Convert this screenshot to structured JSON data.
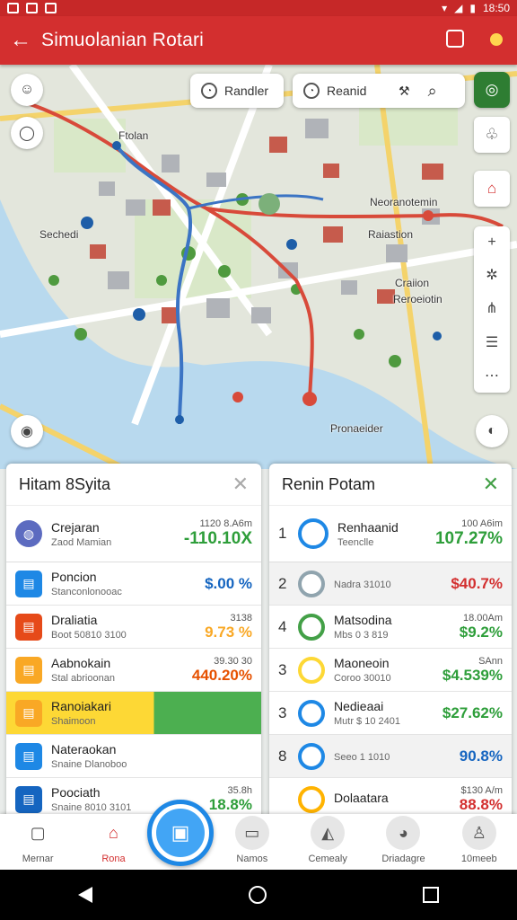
{
  "status_bar": {
    "time": "18:50"
  },
  "app_bar": {
    "title": "Simuolanian Rotari"
  },
  "map": {
    "chip_left": "Randler",
    "chip_right": "Reanid",
    "labels": [
      "Ftolan",
      "Sechedi",
      "Neoranotemin",
      "Raiastion",
      "Craiion",
      "Reroeiotin",
      "Pronaeider"
    ]
  },
  "left_panel": {
    "title": "Hitam 8Syita",
    "summary": {
      "name": "Crejaran",
      "sub": "Zaod Mamian",
      "top": "1120 8.A6m",
      "value": "-110.10X"
    },
    "rows": [
      {
        "name": "Poncion",
        "sub": "Stanconlonooac",
        "top": "",
        "value": "$.00 %",
        "color": "blue",
        "icon_color": "#1e88e5",
        "bg": ""
      },
      {
        "name": "Draliatia",
        "sub": "Boot 50810 3100",
        "top": "3138",
        "value": "9.73 %",
        "color": "yel",
        "icon_color": "#e64a19",
        "bg": ""
      },
      {
        "name": "Aabnokain",
        "sub": "Stal abrioonan",
        "top": "39.30 30",
        "value": "440.20%",
        "color": "orange",
        "icon_color": "#f9a825",
        "bg": ""
      },
      {
        "name": "Ranoiakari",
        "sub": "Shaimoon",
        "top": "",
        "value": "",
        "color": "green",
        "icon_color": "#f9a825",
        "bg": "highlight"
      },
      {
        "name": "Nateraokan",
        "sub": "Snaine Dlanoboo",
        "top": "",
        "value": "",
        "color": "blue",
        "icon_color": "#1e88e5",
        "bg": ""
      },
      {
        "name": "Poociath",
        "sub": "Snaine 8010 3101",
        "top": "35.8h",
        "value": "18.8%",
        "color": "green",
        "icon_color": "#1565c0",
        "bg": ""
      }
    ]
  },
  "right_panel": {
    "title": "Renin Potam",
    "summary": {
      "num": "1",
      "name": "Renhaanid",
      "sub": "Teenclle",
      "top": "100 A6im",
      "value": "107.27%"
    },
    "rows": [
      {
        "num": "2",
        "name": "",
        "sub": "Nadra 31010",
        "top": "",
        "value": "$40.7%",
        "color": "red",
        "alt": true
      },
      {
        "num": "4",
        "name": "Matsodina",
        "sub": "Mbs 0 3 819",
        "top": "18.00Am",
        "value": "$9.2%",
        "color": "green",
        "alt": false
      },
      {
        "num": "3",
        "name": "Maoneoin",
        "sub": "Coroo 30010",
        "top": "SAnn",
        "value": "$4.539%",
        "color": "green",
        "alt": false
      },
      {
        "num": "3",
        "name": "Nedieaai",
        "sub": "Mutr $ 10 2401",
        "top": "",
        "value": "$27.62%",
        "color": "green",
        "alt": false
      },
      {
        "num": "8",
        "name": "",
        "sub": "Seeo 1 1010",
        "top": "",
        "value": "90.8%",
        "color": "blue",
        "alt": true
      },
      {
        "num": "",
        "name": "Dolaatara",
        "sub": "",
        "top": "$130 A/m",
        "value": "88.8%",
        "color": "red",
        "alt": false
      }
    ]
  },
  "bottom_nav": [
    {
      "label": "Mernar",
      "icon": "clipboard-icon"
    },
    {
      "label": "Rona",
      "icon": "home-icon"
    },
    {
      "label": "Namos",
      "icon": "briefcase-icon"
    },
    {
      "label": "Cemealy",
      "icon": "compass-icon"
    },
    {
      "label": "Driadagre",
      "icon": "chat-icon"
    },
    {
      "label": "10meeb",
      "icon": "user-icon"
    }
  ]
}
